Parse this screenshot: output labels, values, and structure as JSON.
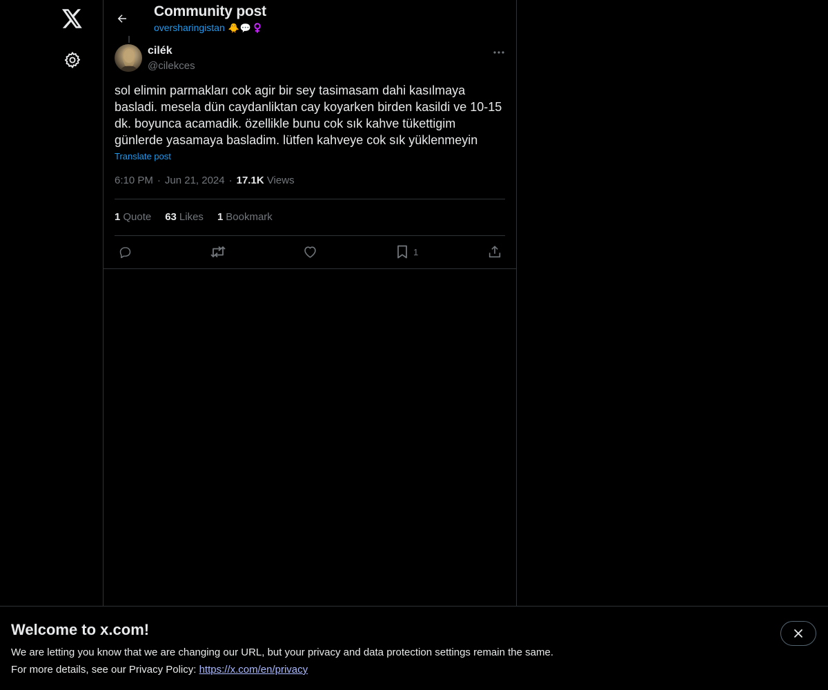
{
  "nav": {
    "logo_icon": "x-logo-icon",
    "settings_icon": "gear-icon"
  },
  "header": {
    "title": "Community post",
    "community_name": "oversharingistan",
    "community_emojis": [
      "🐥",
      "💬",
      "♀️"
    ]
  },
  "post": {
    "author": {
      "name": "cilék",
      "handle": "@cilekces"
    },
    "text": "sol elimin parmakları cok agir bir sey tasimasam dahi kasılmaya basladi. mesela dün caydanliktan cay koyarken birden kasildi ve 10-15 dk. boyunca acamadik. özellikle bunu cok sık kahve tükettigim günlerde yasamaya basladim. lütfen kahveye cok sık yüklenmeyin",
    "translate_label": "Translate post",
    "time": "6:10 PM",
    "date": "Jun 21, 2024",
    "separator": "·",
    "views_count": "17.1K",
    "views_label": "Views",
    "stats": {
      "quotes_count": "1",
      "quotes_label": "Quote",
      "likes_count": "63",
      "likes_label": "Likes",
      "bookmarks_count": "1",
      "bookmarks_label": "Bookmark"
    },
    "actions": {
      "bookmark_count": "1"
    }
  },
  "banner": {
    "title": "Welcome to x.com!",
    "line1": "We are letting you know that we are changing our URL, but your privacy and data protection settings remain the same.",
    "line2_prefix": "For more details, see our Privacy Policy: ",
    "privacy_link": "https://x.com/en/privacy"
  },
  "colors": {
    "background": "#000000",
    "text": "#e7e9ea",
    "muted": "#71767b",
    "accent": "#1d9bf0",
    "border": "#2f3336",
    "link": "#a9b8ff"
  }
}
